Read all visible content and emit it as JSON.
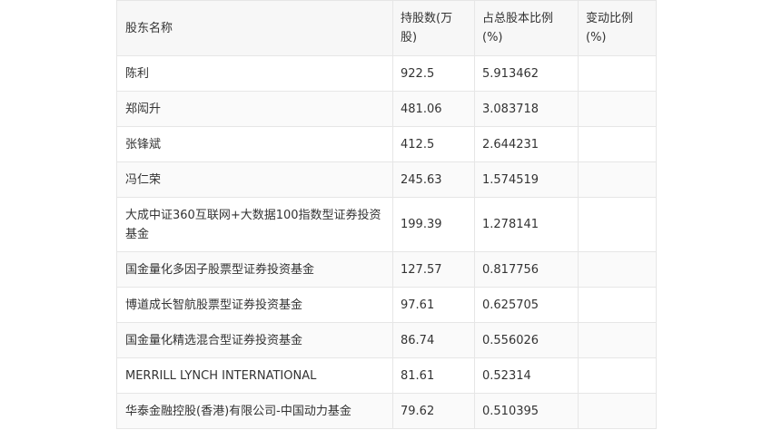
{
  "table": {
    "headers": [
      "股东名称",
      "持股数(万股)",
      "占总股本比例(%)",
      "变动比例(%)"
    ],
    "rows": [
      [
        "陈利",
        "922.5",
        "5.913462",
        ""
      ],
      [
        "郑闳升",
        "481.06",
        "3.083718",
        ""
      ],
      [
        "张锋斌",
        "412.5",
        "2.644231",
        ""
      ],
      [
        "冯仁荣",
        "245.63",
        "1.574519",
        ""
      ],
      [
        "大成中证360互联网+大数据100指数型证券投资基金",
        "199.39",
        "1.278141",
        ""
      ],
      [
        "国金量化多因子股票型证券投资基金",
        "127.57",
        "0.817756",
        ""
      ],
      [
        "博道成长智航股票型证券投资基金",
        "97.61",
        "0.625705",
        ""
      ],
      [
        "国金量化精选混合型证券投资基金",
        "86.74",
        "0.556026",
        ""
      ],
      [
        "MERRILL LYNCH INTERNATIONAL",
        "81.61",
        "0.52314",
        ""
      ],
      [
        "华泰金融控股(香港)有限公司-中国动力基金",
        "79.62",
        "0.510395",
        ""
      ]
    ]
  }
}
